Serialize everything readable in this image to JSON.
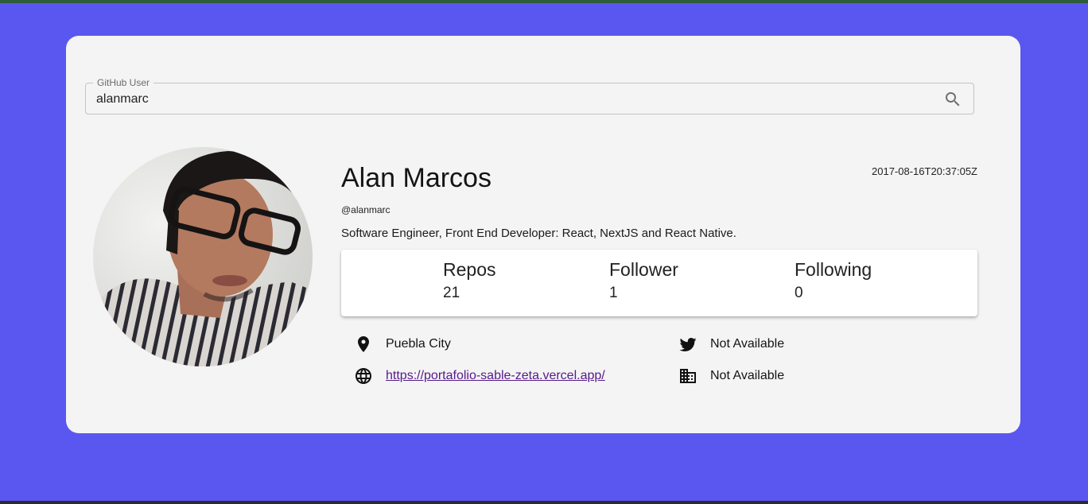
{
  "search": {
    "legend": "GitHub User",
    "value": "alanmarc",
    "icon": "search-icon"
  },
  "profile": {
    "name": "Alan Marcos",
    "username": "@alanmarc",
    "joined": "2017-08-16T20:37:05Z",
    "bio": "Software Engineer, Front End Developer: React, NextJS and React Native."
  },
  "stats": [
    {
      "label": "Repos",
      "value": "21"
    },
    {
      "label": "Follower",
      "value": "1"
    },
    {
      "label": "Following",
      "value": "0"
    }
  ],
  "links": {
    "location": {
      "icon": "location-pin-icon",
      "text": "Puebla City"
    },
    "website": {
      "icon": "globe-icon",
      "text": "https://portafolio-sable-zeta.vercel.app/"
    },
    "twitter": {
      "icon": "twitter-icon",
      "text": "Not Available"
    },
    "company": {
      "icon": "building-icon",
      "text": "Not Available"
    }
  },
  "colors": {
    "background": "#5a57f0",
    "card": "#f4f4f4",
    "link": "#551a8b"
  }
}
